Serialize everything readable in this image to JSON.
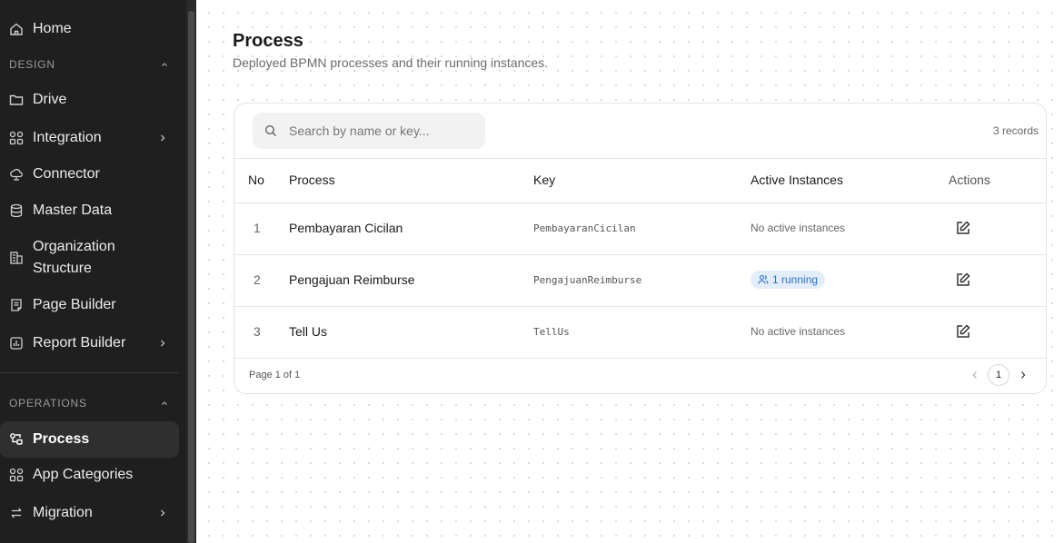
{
  "sidebar": {
    "home": "Home",
    "design_section": "DESIGN",
    "design_items": [
      {
        "label": "Drive",
        "icon": "folder-icon"
      },
      {
        "label": "Integration",
        "icon": "grid-icon"
      },
      {
        "label": "Connector",
        "icon": "cloud-icon"
      },
      {
        "label": "Master Data",
        "icon": "database-icon"
      },
      {
        "label": "Organization Structure",
        "line1": "Organization",
        "line2": "Structure",
        "icon": "building-icon"
      },
      {
        "label": "Page Builder",
        "icon": "page-icon"
      },
      {
        "label": "Report Builder",
        "icon": "chart-icon"
      }
    ],
    "operations_section": "OPERATIONS",
    "operations_items": [
      {
        "label": "Process",
        "icon": "process-icon",
        "active": true
      },
      {
        "label": "App Categories",
        "icon": "grid-icon"
      },
      {
        "label": "Migration",
        "icon": "arrows-icon"
      }
    ]
  },
  "page": {
    "title": "Process",
    "subtitle": "Deployed BPMN processes and their running instances."
  },
  "toolbar": {
    "search_placeholder": "Search by name or key...",
    "records": "3 records"
  },
  "table": {
    "headers": {
      "no": "No",
      "process": "Process",
      "key": "Key",
      "instances": "Active Instances",
      "actions": "Actions"
    },
    "rows": [
      {
        "no": "1",
        "process": "Pembayaran Cicilan",
        "key": "PembayaranCicilan",
        "instances": "No active instances",
        "running": false
      },
      {
        "no": "2",
        "process": "Pengajuan Reimburse",
        "key": "PengajuanReimburse",
        "instances": "1 running",
        "running": true
      },
      {
        "no": "3",
        "process": "Tell Us",
        "key": "TellUs",
        "instances": "No active instances",
        "running": false
      }
    ]
  },
  "pagination": {
    "summary": "Page 1 of 1",
    "current": "1"
  },
  "colors": {
    "sidebar_bg": "#1f1f1f",
    "badge_bg": "#e4eefb",
    "badge_text": "#2d6fc4"
  }
}
